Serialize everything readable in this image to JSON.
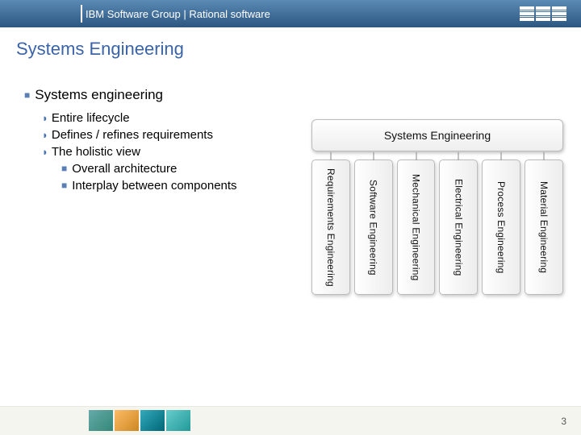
{
  "header": {
    "title": "IBM Software Group | Rational software",
    "logo_name": "ibm-logo"
  },
  "slide_title": "Systems Engineering",
  "bullets": {
    "lvl1": "Systems engineering",
    "lvl2": [
      "Entire lifecycle",
      "Defines / refines requirements",
      "The holistic view"
    ],
    "lvl3": [
      "Overall architecture",
      "Interplay between components"
    ]
  },
  "diagram": {
    "top_label": "Systems Engineering",
    "columns": [
      "Requirements Engineering",
      "Software Engineering",
      "Mechanical Engineering",
      "Electrical Engineering",
      "Process Engineering",
      "Material Engineering"
    ]
  },
  "page_number": "3"
}
